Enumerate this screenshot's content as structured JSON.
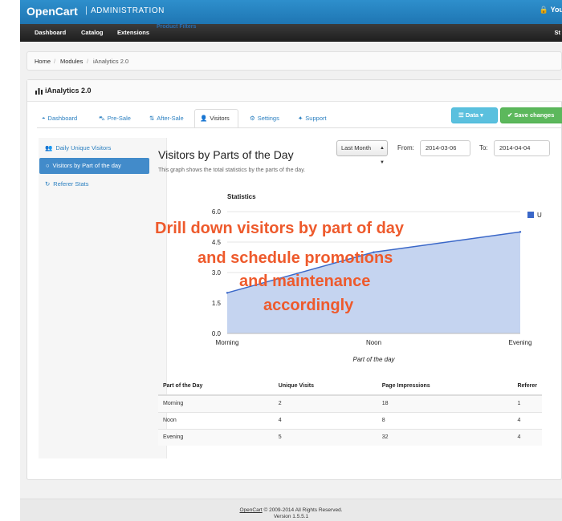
{
  "header": {
    "brand": "OpenCart",
    "separator": "|",
    "subtitle": "ADMINISTRATION",
    "user": "You"
  },
  "menu": {
    "items": [
      "Dashboard",
      "Catalog",
      "Extensions"
    ],
    "extra": "Product Filters",
    "right": "St"
  },
  "breadcrumb": [
    "Home",
    "Modules",
    "iAnalytics 2.0"
  ],
  "box": {
    "title": "iAnalytics 2.0"
  },
  "tabs": [
    {
      "label": "Dashboard",
      "icon": "dashboard-icon"
    },
    {
      "label": "Pre-Sale",
      "icon": "cart-icon"
    },
    {
      "label": "After-Sale",
      "icon": "sort-icon"
    },
    {
      "label": "Visitors",
      "icon": "user-icon"
    },
    {
      "label": "Settings",
      "icon": "cogs-icon"
    },
    {
      "label": "Support",
      "icon": "support-icon"
    }
  ],
  "active_tab": "Visitors",
  "buttons": {
    "data": "Data",
    "save": "Save changes"
  },
  "sidebar": {
    "items": [
      {
        "label": "Daily Unique Visitors",
        "icon": "users-icon"
      },
      {
        "label": "Visitors by Part of the day",
        "icon": "circle-icon"
      },
      {
        "label": "Referer Stats",
        "icon": "refresh-icon"
      }
    ]
  },
  "content": {
    "title": "Visitors by Parts of the Day",
    "description": "This graph shows the total statistics by the parts of the day.",
    "range_select": "Last Month",
    "from_label": "From:",
    "from_value": "2014-03-06",
    "to_label": "To:",
    "to_value": "2014-04-04"
  },
  "chart_data": {
    "type": "area",
    "title": "Statistics",
    "categories": [
      "Morning",
      "Noon",
      "Evening"
    ],
    "series": [
      {
        "name": "U",
        "values": [
          2,
          4,
          5
        ]
      }
    ],
    "xlabel": "Part of the day",
    "ylabel": "",
    "ylim": [
      0,
      6
    ],
    "yticks": [
      "0.0",
      "1.5",
      "3.0",
      "4.5",
      "6.0"
    ],
    "legend": "top-right",
    "colors": {
      "fill": "#c5d4f0",
      "line": "#3a67c8"
    }
  },
  "overlay_text": [
    "Drill down visitors by part of day",
    "and schedule promotions",
    "and maintenance",
    "accordingly"
  ],
  "table": {
    "headers": [
      "Part of the Day",
      "Unique Visits",
      "Page Impressions",
      "Referer"
    ],
    "rows": [
      [
        "Morning",
        "2",
        "18",
        "1"
      ],
      [
        "Noon",
        "4",
        "8",
        "4"
      ],
      [
        "Evening",
        "5",
        "32",
        "4"
      ]
    ]
  },
  "footer": {
    "link": "OpenCart",
    "copyright": " © 2009-2014 All Rights Reserved.",
    "version": "Version 1.5.5.1"
  }
}
